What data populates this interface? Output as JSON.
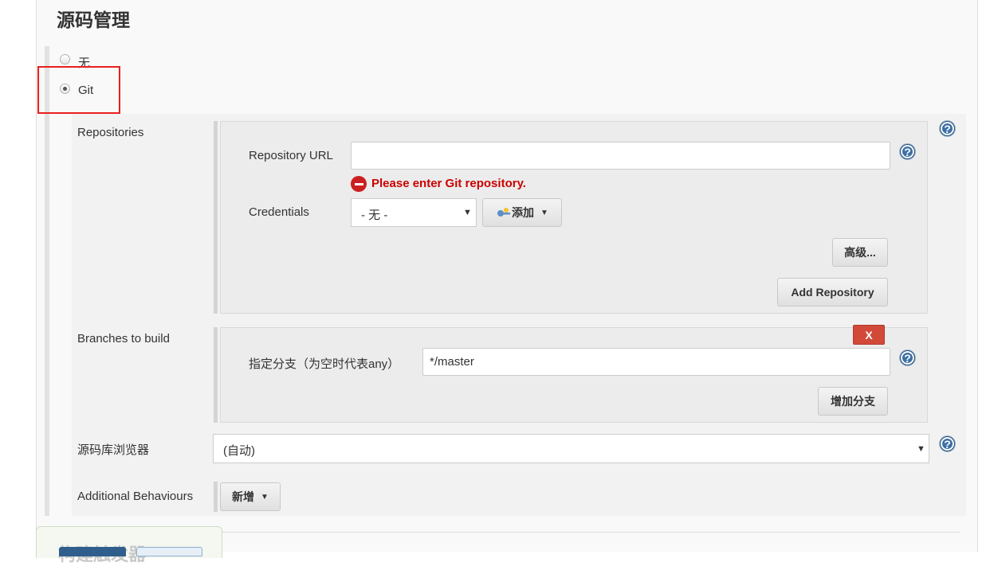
{
  "section": {
    "title": "源码管理"
  },
  "scm_options": [
    {
      "label": "无",
      "checked": false
    },
    {
      "label": "Git",
      "checked": true
    }
  ],
  "repositories": {
    "label": "Repositories",
    "url_label": "Repository URL",
    "url_value": "",
    "error_message": "Please enter Git repository.",
    "credentials_label": "Credentials",
    "credentials_selected": "- 无 -",
    "add_label": "添加",
    "advanced_label": "高级...",
    "add_repository_label": "Add Repository"
  },
  "branches": {
    "label": "Branches to build",
    "delete_label": "X",
    "branch_spec_label": "指定分支（为空时代表any）",
    "branch_spec_value": "*/master",
    "add_branch_label": "增加分支"
  },
  "repo_browser": {
    "label": "源码库浏览器",
    "selected": "(自动)"
  },
  "additional_behaviours": {
    "label": "Additional Behaviours",
    "add_label": "新增"
  },
  "help_icon_glyph": "?",
  "bottom_section": {
    "title": "构建触发器"
  },
  "colors": {
    "error": "#cc0000",
    "help_icon": "#3d6fa5",
    "highlight": "#e8201e",
    "delete_button": "#d24939"
  }
}
